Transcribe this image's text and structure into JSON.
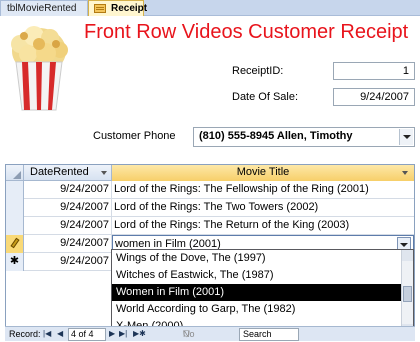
{
  "tabs": [
    {
      "label": "tblMovieRented"
    },
    {
      "label": "Receipt"
    }
  ],
  "form": {
    "title": "Front Row Videos Customer Receipt",
    "receipt_id_label": "ReceiptID:",
    "receipt_id_value": "1",
    "date_of_sale_label": "Date Of Sale:",
    "date_of_sale_value": "9/24/2007",
    "customer_phone_label": "Customer Phone",
    "customer_phone_value": "(810) 555-8945 Allen, Timothy"
  },
  "datasheet": {
    "columns": [
      "DateRented",
      "Movie Title"
    ],
    "rows": [
      {
        "date": "9/24/2007",
        "title": "Lord of the Rings: The Fellowship of the Ring (2001)"
      },
      {
        "date": "9/24/2007",
        "title": "Lord of the Rings: The Two Towers (2002)"
      },
      {
        "date": "9/24/2007",
        "title": "Lord of the Rings: The Return of the King (2003)"
      },
      {
        "date": "9/24/2007",
        "title": "women in Film (2001)"
      },
      {
        "date": "9/24/2007",
        "title": ""
      }
    ],
    "new_record_marker": "✱"
  },
  "dropdown": {
    "items": [
      "Wings of the Dove, The (1997)",
      "Witches of Eastwick, The (1987)",
      "Women in Film (2001)",
      "World According to Garp, The (1982)",
      "X-Men (2000)"
    ],
    "selected_index": 2
  },
  "navigator": {
    "record_label": "Record:",
    "position": "4 of 4",
    "filter_label": "No Filter",
    "search_label": "Search"
  },
  "colors": {
    "title": "#e8141c",
    "header_highlight": "#f7cf69"
  },
  "icons": {
    "form_tab": "form-icon",
    "popcorn": "popcorn-image"
  }
}
